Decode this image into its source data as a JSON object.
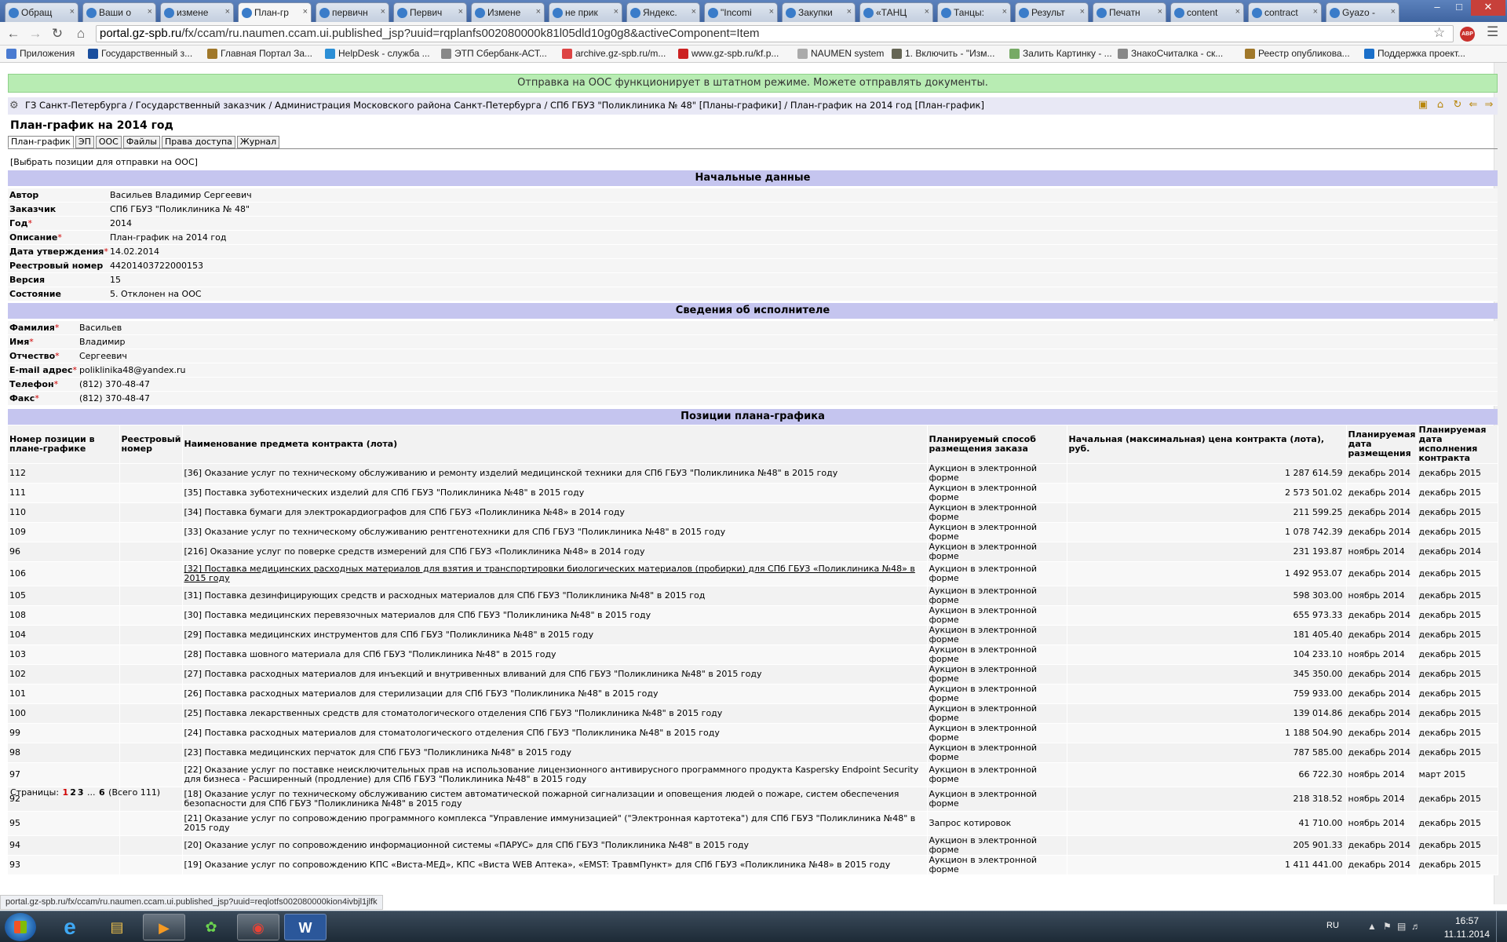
{
  "browser": {
    "tabs": [
      {
        "title": "Обращ"
      },
      {
        "title": "Ваши о"
      },
      {
        "title": "измене"
      },
      {
        "title": "План-гр"
      },
      {
        "title": "первичн"
      },
      {
        "title": "Первич"
      },
      {
        "title": "Измене"
      },
      {
        "title": "не прик"
      },
      {
        "title": "Яндекс."
      },
      {
        "title": "\"Incomi"
      },
      {
        "title": "Закупки"
      },
      {
        "title": "«ТАНЦ"
      },
      {
        "title": "Танцы:"
      },
      {
        "title": "Результ"
      },
      {
        "title": "Печатн"
      },
      {
        "title": "content"
      },
      {
        "title": "contract"
      },
      {
        "title": "Gyazo -"
      }
    ],
    "url_host": "portal.gz-spb.ru",
    "url_path": "/fx/ccam/ru.naumen.ccam.ui.published_jsp?uuid=rqplanfs002080000k81l05dld10g0g8&activeComponent=Item",
    "bookmarks": [
      "Приложения",
      "Государственный з...",
      "Главная Портал За...",
      "HelpDesk - служба ...",
      "ЭТП Сбербанк-АСТ...",
      "archive.gz-spb.ru/m...",
      "www.gz-spb.ru/kf.p...",
      "NAUMEN system",
      "1. Включить - \"Изм...",
      "Залить Картинку - ...",
      "ЗнакоСчиталка - ск...",
      "Реестр опубликова...",
      "Поддержка проект..."
    ],
    "abp_label": "ABP",
    "status_url": "portal.gz-spb.ru/fx/ccam/ru.naumen.ccam.ui.published_jsp?uuid=reqlotfs002080000kion4ivbjl1jlfk"
  },
  "banner": "Отправка на ООС функционирует в штатном режиме. Можете отправлять документы.",
  "breadcrumb": "ГЗ Санкт-Петербурга / Государственный заказчик / Администрация Московского района Санкт-Петербурга / СПб ГБУЗ \"Поликлиника № 48\" [Планы-графики] / План-график на 2014 год [План-график]",
  "page_title": "План-график на 2014 год",
  "sub_tabs": [
    "План-график",
    "ЭП",
    "ООС",
    "Файлы",
    "Права доступа",
    "Журнал"
  ],
  "select_link": "[Выбрать позиции для отправки на ООС]",
  "initial_data": {
    "section_title": "Начальные данные",
    "rows": [
      {
        "label": "Автор",
        "required": false,
        "value": "Васильев Владимир Сергеевич"
      },
      {
        "label": "Заказчик",
        "required": false,
        "value": "СПб ГБУЗ \"Поликлиника № 48\""
      },
      {
        "label": "Год",
        "required": true,
        "value": "2014"
      },
      {
        "label": "Описание",
        "required": true,
        "value": "План-график на 2014 год"
      },
      {
        "label": "Дата утверждения",
        "required": true,
        "value": "14.02.2014"
      },
      {
        "label": "Реестровый номер",
        "required": false,
        "value": "44201403722000153"
      },
      {
        "label": "Версия",
        "required": false,
        "value": "15"
      },
      {
        "label": "Состояние",
        "required": false,
        "value": "5. Отклонен на ООС"
      }
    ]
  },
  "executor": {
    "section_title": "Сведения об исполнителе",
    "rows": [
      {
        "label": "Фамилия",
        "required": true,
        "value": "Васильев"
      },
      {
        "label": "Имя",
        "required": true,
        "value": "Владимир"
      },
      {
        "label": "Отчество",
        "required": true,
        "value": "Сергеевич"
      },
      {
        "label": "E-mail адрес",
        "required": true,
        "value": "poliklinika48@yandex.ru"
      },
      {
        "label": "Телефон",
        "required": true,
        "value": "(812) 370-48-47"
      },
      {
        "label": "Факс",
        "required": true,
        "value": "(812) 370-48-47"
      }
    ]
  },
  "positions": {
    "section_title": "Позиции плана-графика",
    "headers": [
      "Номер позиции в плане-графике",
      "Реестровый номер",
      "Наименование предмета контракта (лота)",
      "Планируемый способ размещения заказа",
      "Начальная (максимальная) цена контракта (лота), руб.",
      "Планируемая дата размещения",
      "Планируемая дата исполнения контракта"
    ],
    "rows": [
      {
        "num": "112",
        "reg": "",
        "name": "[36] Оказание услуг по техническому обслуживанию и ремонту изделий медицинской техники для СПб ГБУЗ \"Поликлиника №48\" в 2015 году",
        "method": "Аукцион в электронной форме",
        "price": "1 287 614.59",
        "place_date": "декабрь 2014",
        "exec_date": "декабрь 2015"
      },
      {
        "num": "111",
        "reg": "",
        "name": "[35] Поставка зуботехнических изделий для СПб ГБУЗ \"Поликлиника №48\" в 2015 году",
        "method": "Аукцион в электронной форме",
        "price": "2 573 501.02",
        "place_date": "декабрь 2014",
        "exec_date": "декабрь 2015"
      },
      {
        "num": "110",
        "reg": "",
        "name": "[34] Поставка бумаги для электрокардиографов для СПб ГБУЗ «Поликлиника №48» в 2014 году",
        "method": "Аукцион в электронной форме",
        "price": "211 599.25",
        "place_date": "декабрь 2014",
        "exec_date": "декабрь 2015"
      },
      {
        "num": "109",
        "reg": "",
        "name": "[33] Оказание услуг по техническому обслуживанию рентгенотехники для СПб ГБУЗ \"Поликлиника №48\" в 2015 году",
        "method": "Аукцион в электронной форме",
        "price": "1 078 742.39",
        "place_date": "декабрь 2014",
        "exec_date": "декабрь 2015"
      },
      {
        "num": "96",
        "reg": "",
        "name": "[216] Оказание услуг по поверке средств измерений для СПб ГБУЗ «Поликлиника №48» в 2014 году",
        "method": "Аукцион в электронной форме",
        "price": "231 193.87",
        "place_date": "ноябрь 2014",
        "exec_date": "декабрь 2014"
      },
      {
        "num": "106",
        "reg": "",
        "name": "[32] Поставка медицинских расходных материалов для взятия и транспортировки биологических материалов (пробирки) для СПб ГБУЗ «Поликлиника №48» в 2015 году",
        "method": "Аукцион в электронной форме",
        "price": "1 492 953.07",
        "place_date": "декабрь 2014",
        "exec_date": "декабрь 2015",
        "link": true
      },
      {
        "num": "105",
        "reg": "",
        "name": "[31] Поставка дезинфицирующих средств и расходных материалов для СПб ГБУЗ \"Поликлиника №48\" в 2015 год",
        "method": "Аукцион в электронной форме",
        "price": "598 303.00",
        "place_date": "ноябрь 2014",
        "exec_date": "декабрь 2015"
      },
      {
        "num": "108",
        "reg": "",
        "name": "[30] Поставка медицинских перевязочных материалов для СПб ГБУЗ \"Поликлиника №48\" в 2015 году",
        "method": "Аукцион в электронной форме",
        "price": "655 973.33",
        "place_date": "декабрь 2014",
        "exec_date": "декабрь 2015"
      },
      {
        "num": "104",
        "reg": "",
        "name": "[29] Поставка медицинских инструментов для СПб ГБУЗ \"Поликлиника №48\" в 2015 году",
        "method": "Аукцион в электронной форме",
        "price": "181 405.40",
        "place_date": "декабрь 2014",
        "exec_date": "декабрь 2015"
      },
      {
        "num": "103",
        "reg": "",
        "name": "[28] Поставка шовного материала для СПб ГБУЗ \"Поликлиника №48\" в 2015 году",
        "method": "Аукцион в электронной форме",
        "price": "104 233.10",
        "place_date": "ноябрь 2014",
        "exec_date": "декабрь 2015"
      },
      {
        "num": "102",
        "reg": "",
        "name": "[27] Поставка расходных материалов для инъекций и внутривенных вливаний для СПб ГБУЗ \"Поликлиника №48\" в 2015 году",
        "method": "Аукцион в электронной форме",
        "price": "345 350.00",
        "place_date": "декабрь 2014",
        "exec_date": "декабрь 2015"
      },
      {
        "num": "101",
        "reg": "",
        "name": "[26] Поставка расходных материалов для стерилизации для СПб ГБУЗ \"Поликлиника №48\" в 2015 году",
        "method": "Аукцион в электронной форме",
        "price": "759 933.00",
        "place_date": "декабрь 2014",
        "exec_date": "декабрь 2015"
      },
      {
        "num": "100",
        "reg": "",
        "name": "[25] Поставка лекарственных средств для стоматологического отделения СПб ГБУЗ \"Поликлиника №48\" в 2015 году",
        "method": "Аукцион в электронной форме",
        "price": "139 014.86",
        "place_date": "декабрь 2014",
        "exec_date": "декабрь 2015"
      },
      {
        "num": "99",
        "reg": "",
        "name": "[24] Поставка расходных материалов для стоматологического отделения СПб ГБУЗ \"Поликлиника №48\" в 2015 году",
        "method": "Аукцион в электронной форме",
        "price": "1 188 504.90",
        "place_date": "декабрь 2014",
        "exec_date": "декабрь 2015"
      },
      {
        "num": "98",
        "reg": "",
        "name": "[23] Поставка медицинских перчаток для СПб ГБУЗ \"Поликлиника №48\" в 2015 году",
        "method": "Аукцион в электронной форме",
        "price": "787 585.00",
        "place_date": "декабрь 2014",
        "exec_date": "декабрь 2015"
      },
      {
        "num": "97",
        "reg": "",
        "name": "[22] Оказание услуг по поставке неисключительных прав на использование лицензионного антивирусного программного продукта Kaspersky Endpoint Security для бизнеса - Расширенный (продление) для СПб ГБУЗ \"Поликлиника №48\" в 2015 году",
        "method": "Аукцион в электронной форме",
        "price": "66 722.30",
        "place_date": "ноябрь 2014",
        "exec_date": "март 2015"
      },
      {
        "num": "92",
        "reg": "",
        "name": "[18] Оказание услуг по техническому обслуживанию систем автоматической пожарной сигнализации и оповещения людей о пожаре, систем обеспечения безопасности для СПб ГБУЗ \"Поликлиника №48\" в 2015 году",
        "method": "Аукцион в электронной форме",
        "price": "218 318.52",
        "place_date": "ноябрь 2014",
        "exec_date": "декабрь 2015"
      },
      {
        "num": "95",
        "reg": "",
        "name": "[21] Оказание услуг по сопровождению программного комплекса \"Управление иммунизацией\" (\"Электронная картотека\") для СПб ГБУЗ \"Поликлиника №48\" в 2015 году",
        "method": "Запрос котировок",
        "price": "41 710.00",
        "place_date": "ноябрь 2014",
        "exec_date": "декабрь 2015"
      },
      {
        "num": "94",
        "reg": "",
        "name": "[20] Оказание услуг по сопровождению информационной системы «ПАРУС» для СПб ГБУЗ \"Поликлиника №48\" в 2015 году",
        "method": "Аукцион в электронной форме",
        "price": "205 901.33",
        "place_date": "декабрь 2014",
        "exec_date": "декабрь 2015"
      },
      {
        "num": "93",
        "reg": "",
        "name": "[19] Оказание услуг по сопровождению КПС «Виста-МЕД», КПС «Виста WEB Аптека», «EMST: ТравмПункт» для СПб ГБУЗ «Поликлиника №48» в 2015 году",
        "method": "Аукцион в электронной форме",
        "price": "1 411 441.00",
        "place_date": "декабрь 2014",
        "exec_date": "декабрь 2015"
      }
    ]
  },
  "pager": {
    "label": "Страницы:",
    "pages": [
      "1",
      "2",
      "3"
    ],
    "ellipsis": "...",
    "last": "6",
    "total": "(Всего 111)",
    "current": "1"
  },
  "taskbar": {
    "lang": "RU",
    "time": "16:57",
    "date": "11.11.2014"
  }
}
